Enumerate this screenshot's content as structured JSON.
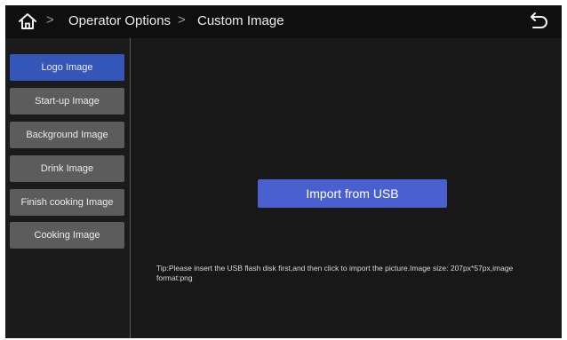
{
  "header": {
    "breadcrumb": [
      "Operator Options",
      "Custom Image"
    ],
    "separator": ">",
    "home_icon": "home-icon",
    "back_icon": "undo-arrow-icon"
  },
  "sidebar": {
    "items": [
      {
        "label": "Logo Image",
        "active": true
      },
      {
        "label": "Start-up Image",
        "active": false
      },
      {
        "label": "Background Image",
        "active": false
      },
      {
        "label": "Drink Image",
        "active": false
      },
      {
        "label": "Finish cooking Image",
        "active": false
      },
      {
        "label": "Cooking Image",
        "active": false
      }
    ]
  },
  "main": {
    "import_label": "Import from USB",
    "tip": "Tip:Please insert the USB flash disk first,and then click to import the picture.Image size: 207px*57px,image format:png"
  },
  "colors": {
    "active_item": "#3356b8",
    "import_button": "#4a5fd0",
    "menu_item": "#5c5c5c",
    "background": "#181818"
  }
}
